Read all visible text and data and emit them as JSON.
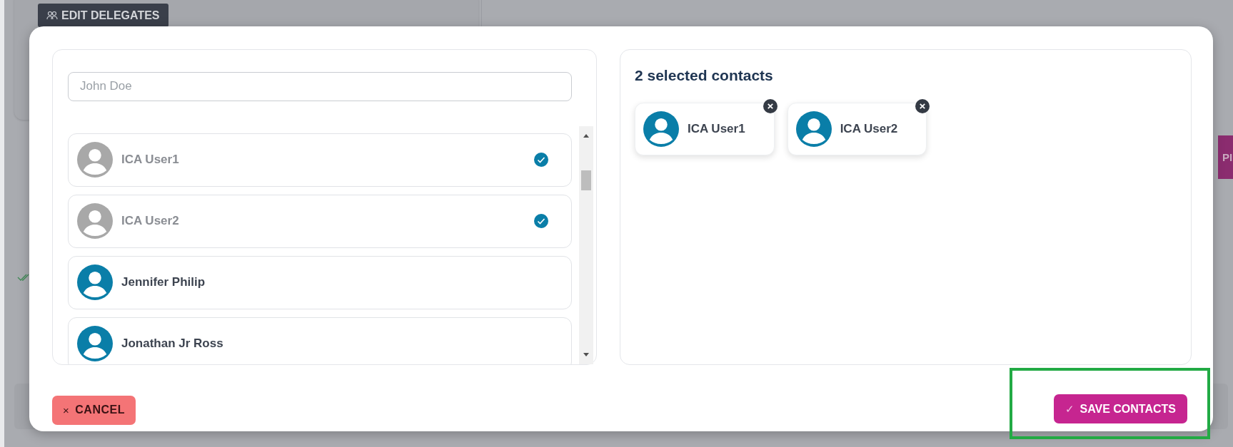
{
  "background_page": {
    "edit_button": {
      "label": "EDIT DELEGATES"
    },
    "side_button": {
      "label": "PI"
    }
  },
  "modal": {
    "search": {
      "placeholder": "John Doe"
    },
    "contacts": [
      {
        "name": "ICA User1",
        "selected": true
      },
      {
        "name": "ICA User2",
        "selected": true
      },
      {
        "name": "Jennifer Philip",
        "selected": false
      },
      {
        "name": "Jonathan Jr Ross",
        "selected": false
      }
    ],
    "selected_title": "2 selected contacts",
    "selected_contacts": [
      {
        "name": "ICA User1"
      },
      {
        "name": "ICA User2"
      }
    ],
    "cancel_button": {
      "icon": "×",
      "label": "CANCEL"
    },
    "save_button": {
      "icon": "✓",
      "label": "SAVE CONTACTS",
      "highlighted": true
    }
  }
}
